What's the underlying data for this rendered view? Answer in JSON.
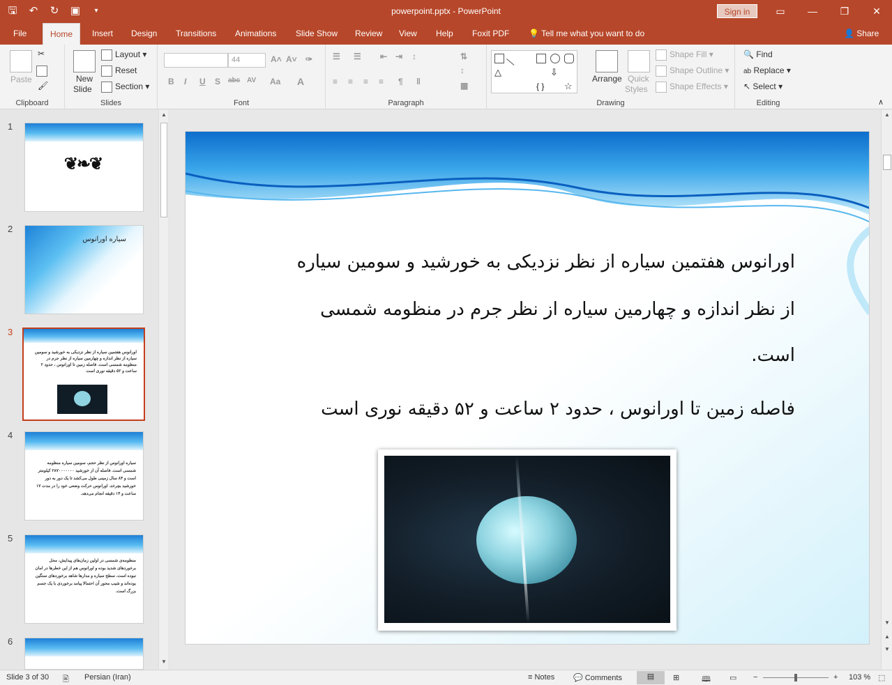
{
  "window": {
    "title": "powerpoint.pptx  -  PowerPoint",
    "signin_label": "Sign in",
    "share_label": "Share"
  },
  "qat": [
    "save-icon",
    "undo-icon",
    "redo-icon",
    "present-icon",
    "customize-icon"
  ],
  "tabs": [
    "File",
    "Home",
    "Insert",
    "Design",
    "Transitions",
    "Animations",
    "Slide Show",
    "Review",
    "View",
    "Help",
    "Foxit PDF"
  ],
  "active_tab": "Home",
  "tell_me": "Tell me what you want to do",
  "ribbon": {
    "clipboard": {
      "paste": "Paste",
      "label": "Clipboard"
    },
    "slides": {
      "new_slide": "New",
      "new_slide_2": "Slide",
      "layout": "Layout",
      "reset": "Reset",
      "section": "Section",
      "label": "Slides"
    },
    "font": {
      "size": "44",
      "label": "Font",
      "bold": "B",
      "italic": "I",
      "underline": "U",
      "shadow": "S",
      "strike": "abc",
      "spacing": "AV",
      "case": "Aa",
      "color": "A"
    },
    "paragraph": {
      "label": "Paragraph"
    },
    "drawing": {
      "arrange": "Arrange",
      "quick_styles": "Quick",
      "quick_styles_2": "Styles",
      "shape_fill": "Shape Fill",
      "shape_outline": "Shape Outline",
      "shape_effects": "Shape Effects",
      "label": "Drawing"
    },
    "editing": {
      "find": "Find",
      "replace": "Replace",
      "select": "Select",
      "label": "Editing"
    }
  },
  "thumbnails": [
    {
      "number": "1",
      "text": ""
    },
    {
      "number": "2",
      "text": "سیاره اورانوس"
    },
    {
      "number": "3",
      "text": "اورانوس هفتمین سیاره از نظر نزدیکی به خورشید و سومین سیاره از نظر اندازه و چهارمین سیاره از نظر جرم در منظومه شمسی است. فاصله زمین تا اورانوس ، حدود ۲ ساعت و ۵۲ دقیقه نوری است"
    },
    {
      "number": "4",
      "text": "سیاره اورانوس از نظر حجم، سومین سیاره منظومه شمسی است. فاصله آن از خورشید ۲۸۷۰۰۰۰۰۰۰ کیلومتر است و ۸۴ سال زمینی طول می‌کشد تا یک دور به دور خورشید بچرخد. اورانوس حرکت وضعی خود را در مدت ۱۷ ساعت و ۱۴ دقیقه انجام می‌دهد."
    },
    {
      "number": "5",
      "text": "منظومه‌ی شمسی در اولین زمان‌های پیدایش، محل برخوردهای شدید بوده و اورانوس هم از این خطرها در امان نبوده است. سطح سیاره و مدارها شاهد برخوردهای سنگین بوده‌اند و شیب محور آن احتمالا پیامد برخوردی با یک جسم بزرگ است."
    },
    {
      "number": "6",
      "text": ""
    }
  ],
  "active_slide": "3",
  "slide": {
    "lines": [
      "اورانوس هفتمین سیاره از نظر نزدیکی به خورشید و سومین سیاره",
      "از نظر اندازه و چهارمین سیاره از نظر جرم در منظومه شمسی",
      "است.",
      "فاصله زمین تا اورانوس ، حدود ۲ ساعت و ۵۲ دقیقه نوری است"
    ],
    "image_alt": "uranus-planet-image"
  },
  "status": {
    "slide_info": "Slide 3 of 30",
    "language": "Persian (Iran)",
    "notes": "Notes",
    "comments": "Comments",
    "zoom": "103 %",
    "zoom_minus": "−",
    "zoom_plus": "+"
  },
  "colors": {
    "accent": "#b7472a",
    "selected_thumb": "#c43e1c"
  }
}
